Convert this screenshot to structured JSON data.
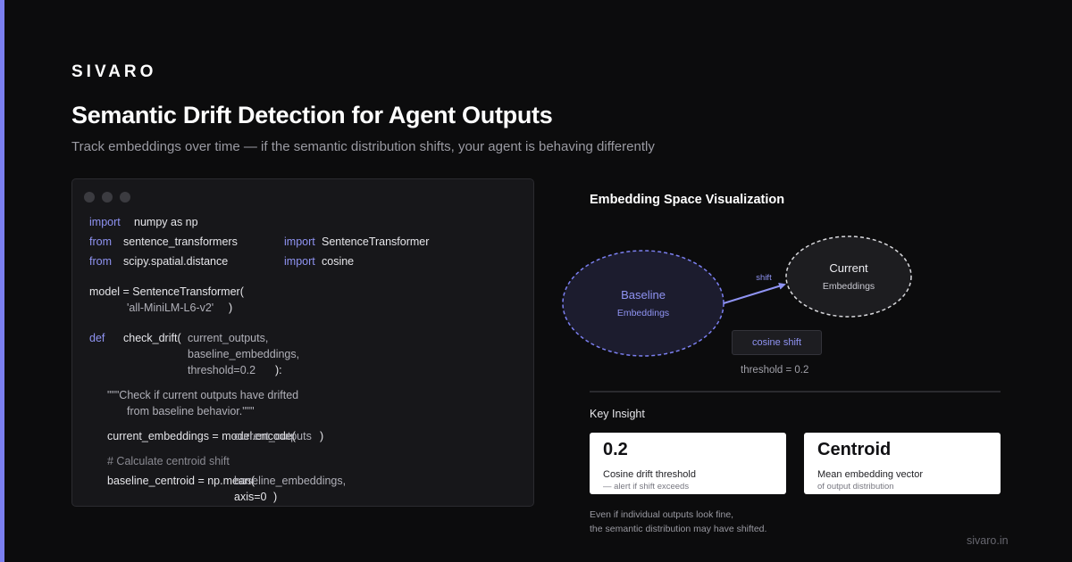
{
  "brand": "SIVARO",
  "title": "Semantic Drift Detection for Agent Outputs",
  "subtitle": "Track embeddings over time — if the semantic distribution shifts, your agent is behaving differently",
  "code": {
    "l1_kw": "import",
    "l1_a": "numpy as np",
    "l2_kw": "from",
    "l2_a": "sentence_transformers",
    "l2_kw2": "import",
    "l2_b": "SentenceTransformer",
    "l3_kw": "from",
    "l3_a": "scipy.spatial.distance",
    "l3_kw2": "import",
    "l3_b": "cosine",
    "l4": "model = SentenceTransformer(",
    "l5_str": "'all-MiniLM-L6-v2'",
    "l5_end": ")",
    "l6_kw": "def",
    "l6_fn": "check_drift(",
    "l6_p": "current_outputs,",
    "l7_p": "baseline_embeddings,",
    "l8_p": "threshold=0.2",
    "l8_end": "):",
    "l9": "\"\"\"Check if current outputs have drifted",
    "l10": "from baseline behavior.\"\"\"",
    "l11_a": "current_embeddings = model.encode(",
    "l11_b": "current_outputs",
    "l11_end": ")",
    "l12": "# Calculate centroid shift",
    "l13_a": "baseline_centroid = np.mean(",
    "l13_b": "baseline_embeddings,",
    "l14_a": "axis=0",
    "l14_end": ")"
  },
  "viz": {
    "title": "Embedding Space Visualization",
    "baseline_name": "Baseline",
    "baseline_sub": "Embeddings",
    "current_name": "Current",
    "current_sub": "Embeddings",
    "shift_label": "shift",
    "cosine_button": "cosine shift",
    "threshold_note": "threshold = 0.2"
  },
  "insight": {
    "heading": "Key Insight",
    "cards": [
      {
        "value": "0.2",
        "label": "Cosine drift threshold",
        "sub": "— alert if shift exceeds"
      },
      {
        "value": "Centroid",
        "label": "Mean embedding vector",
        "sub": "of output distribution"
      }
    ],
    "footnote_1": "Even if individual outputs look fine,",
    "footnote_2": "the semantic distribution may have shifted."
  },
  "site": "sivaro.in",
  "colors": {
    "accent": "#7b7ff0",
    "background": "#0c0c0d",
    "code_bg": "#17171a",
    "card_bg": "#ffffff"
  }
}
